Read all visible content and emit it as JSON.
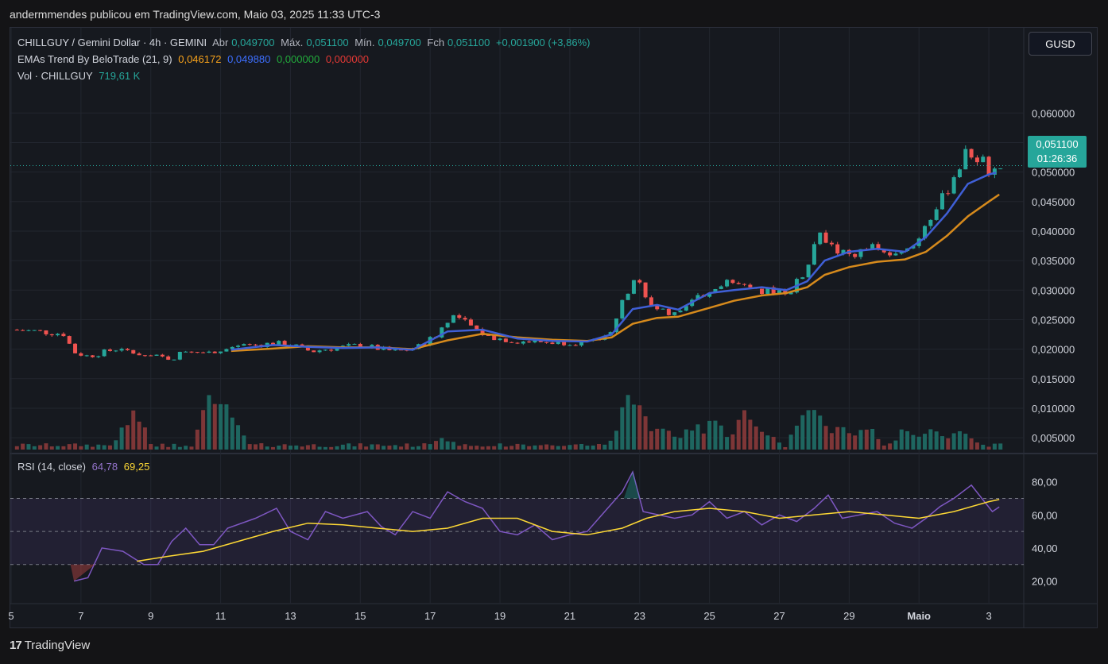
{
  "header": {
    "publisher_line": "andermmendes publicou em TradingView.com, Maio 03, 2025 11:33 UTC-3"
  },
  "symbol_legend": {
    "name": "CHILLGUY / Gemini Dollar · 4h · GEMINI",
    "open_label": "Abr",
    "open": "0,049700",
    "high_label": "Máx.",
    "high": "0,051100",
    "low_label": "Mín.",
    "low": "0,049700",
    "close_label": "Fch",
    "close": "0,051100",
    "change": "+0,001900 (+3,86%)"
  },
  "ema_legend": {
    "name": "EMAs Trend By BeloTrade (21, 9)",
    "v1": "0,046172",
    "v2": "0,049880",
    "v3": "0,000000",
    "v4": "0,000000"
  },
  "vol_legend": {
    "name": "Vol · CHILLGUY",
    "value": "719,61 K"
  },
  "rsi_legend": {
    "name": "RSI (14, close)",
    "rsi": "64,78",
    "ma": "69,25"
  },
  "currency_button": "GUSD",
  "price_tag": {
    "price": "0,051100",
    "countdown": "01:26:36"
  },
  "footer": {
    "brand": "TradingView",
    "logo_text": "17"
  },
  "colors": {
    "up": "#26a69a",
    "down": "#ef5350",
    "ema_fast": "#2962ff",
    "ema_slow": "#d68a1c",
    "rsi": "#7e57c2",
    "rsi_ma": "#fdd835"
  },
  "chart_data": {
    "type": "candlestick",
    "price_axis": {
      "range": [
        0.003,
        0.063
      ],
      "ticks": [
        "0,005000",
        "0,010000",
        "0,015000",
        "0,020000",
        "0,025000",
        "0,030000",
        "0,035000",
        "0,040000",
        "0,045000",
        "0,050000",
        "0,055000",
        "0,060000"
      ],
      "tick_values": [
        0.005,
        0.01,
        0.015,
        0.02,
        0.025,
        0.03,
        0.035,
        0.04,
        0.045,
        0.05,
        0.055,
        0.06
      ]
    },
    "rsi_axis": {
      "range": [
        15,
        88
      ],
      "ticks": [
        "20,00",
        "40,00",
        "60,00",
        "80,00"
      ],
      "tick_values": [
        20,
        40,
        60,
        80
      ],
      "bands": [
        30,
        50,
        70
      ]
    },
    "x_ticks": [
      {
        "label": "5",
        "day": 5
      },
      {
        "label": "7",
        "day": 7
      },
      {
        "label": "9",
        "day": 9
      },
      {
        "label": "11",
        "day": 11
      },
      {
        "label": "13",
        "day": 13
      },
      {
        "label": "15",
        "day": 15
      },
      {
        "label": "17",
        "day": 17
      },
      {
        "label": "19",
        "day": 19
      },
      {
        "label": "21",
        "day": 21
      },
      {
        "label": "23",
        "day": 23
      },
      {
        "label": "25",
        "day": 25
      },
      {
        "label": "27",
        "day": 27
      },
      {
        "label": "29",
        "day": 29
      },
      {
        "label": "Maio",
        "day": 31
      },
      {
        "label": "3",
        "day": 33
      }
    ],
    "close_series": {
      "description_days": [
        5,
        33.4
      ],
      "knots": [
        [
          5,
          0.0233
        ],
        [
          5.8,
          0.023
        ],
        [
          6.5,
          0.0226
        ],
        [
          6.8,
          0.0195
        ],
        [
          7.2,
          0.0188
        ],
        [
          8,
          0.02
        ],
        [
          9,
          0.0188
        ],
        [
          9.6,
          0.0184
        ],
        [
          10,
          0.0198
        ],
        [
          10.5,
          0.0198
        ],
        [
          10.8,
          0.0195
        ],
        [
          11,
          0.0198
        ],
        [
          11.6,
          0.0205
        ],
        [
          12.5,
          0.021
        ],
        [
          13,
          0.0208
        ],
        [
          13.6,
          0.0196
        ],
        [
          14,
          0.02
        ],
        [
          15,
          0.0207
        ],
        [
          15.6,
          0.02
        ],
        [
          16,
          0.0196
        ],
        [
          16.6,
          0.0202
        ],
        [
          17.2,
          0.0225
        ],
        [
          17.6,
          0.0258
        ],
        [
          18,
          0.0246
        ],
        [
          18.6,
          0.0222
        ],
        [
          19.4,
          0.0214
        ],
        [
          20.3,
          0.0212
        ],
        [
          21,
          0.0212
        ],
        [
          21.6,
          0.021
        ],
        [
          22.1,
          0.0225
        ],
        [
          22.6,
          0.029
        ],
        [
          22.9,
          0.0335
        ],
        [
          23.2,
          0.0282
        ],
        [
          23.7,
          0.0262
        ],
        [
          24.1,
          0.0255
        ],
        [
          24.6,
          0.0285
        ],
        [
          25.2,
          0.0308
        ],
        [
          25.7,
          0.0312
        ],
        [
          26.3,
          0.0295
        ],
        [
          26.8,
          0.03
        ],
        [
          27.3,
          0.0298
        ],
        [
          27.8,
          0.0335
        ],
        [
          28.1,
          0.0395
        ],
        [
          28.5,
          0.0372
        ],
        [
          28.9,
          0.0358
        ],
        [
          29.3,
          0.0365
        ],
        [
          29.7,
          0.0375
        ],
        [
          30.3,
          0.0355
        ],
        [
          30.8,
          0.037
        ],
        [
          31.2,
          0.0415
        ],
        [
          31.6,
          0.0445
        ],
        [
          32,
          0.0495
        ],
        [
          32.4,
          0.0535
        ],
        [
          32.8,
          0.052
        ],
        [
          33.1,
          0.0497
        ],
        [
          33.4,
          0.0511
        ]
      ]
    },
    "ema_fast_series": [
      [
        11.3,
        0.0199
      ],
      [
        12.5,
        0.0207
      ],
      [
        13.5,
        0.0204
      ],
      [
        14.5,
        0.0202
      ],
      [
        15.5,
        0.0203
      ],
      [
        16.5,
        0.0199
      ],
      [
        17.5,
        0.023
      ],
      [
        18.5,
        0.0233
      ],
      [
        19.5,
        0.0218
      ],
      [
        20.5,
        0.0214
      ],
      [
        21.5,
        0.0213
      ],
      [
        22.2,
        0.0225
      ],
      [
        22.8,
        0.0268
      ],
      [
        23.5,
        0.0275
      ],
      [
        24.1,
        0.0267
      ],
      [
        25,
        0.0295
      ],
      [
        25.7,
        0.03
      ],
      [
        26.5,
        0.0305
      ],
      [
        27.2,
        0.03
      ],
      [
        27.8,
        0.0315
      ],
      [
        28.3,
        0.035
      ],
      [
        29,
        0.0365
      ],
      [
        29.8,
        0.037
      ],
      [
        30.6,
        0.0365
      ],
      [
        31.2,
        0.039
      ],
      [
        31.8,
        0.043
      ],
      [
        32.4,
        0.048
      ],
      [
        33,
        0.0496
      ],
      [
        33.2,
        0.0499
      ]
    ],
    "ema_slow_series": [
      [
        11.3,
        0.0197
      ],
      [
        12.5,
        0.0201
      ],
      [
        13.5,
        0.0205
      ],
      [
        14.5,
        0.0203
      ],
      [
        15.5,
        0.0203
      ],
      [
        16.5,
        0.02
      ],
      [
        17.5,
        0.0215
      ],
      [
        18.5,
        0.0226
      ],
      [
        19.5,
        0.022
      ],
      [
        20.5,
        0.0216
      ],
      [
        21.5,
        0.0214
      ],
      [
        22.2,
        0.022
      ],
      [
        22.8,
        0.0243
      ],
      [
        23.5,
        0.0253
      ],
      [
        24.1,
        0.0255
      ],
      [
        25,
        0.027
      ],
      [
        25.7,
        0.0282
      ],
      [
        26.5,
        0.0291
      ],
      [
        27.2,
        0.0295
      ],
      [
        27.8,
        0.0305
      ],
      [
        28.3,
        0.0326
      ],
      [
        29,
        0.0339
      ],
      [
        29.8,
        0.0348
      ],
      [
        30.6,
        0.0352
      ],
      [
        31.2,
        0.0365
      ],
      [
        31.8,
        0.0392
      ],
      [
        32.4,
        0.0425
      ],
      [
        33,
        0.045
      ],
      [
        33.3,
        0.0462
      ]
    ],
    "volume_spikes": [
      [
        8.5,
        0.55
      ],
      [
        10.8,
        0.95
      ],
      [
        11.0,
        0.7
      ],
      [
        11.2,
        0.62
      ],
      [
        17.4,
        0.2
      ],
      [
        22.6,
        0.35
      ],
      [
        22.8,
        0.98
      ],
      [
        23.3,
        0.4
      ],
      [
        23.7,
        0.3
      ],
      [
        24.6,
        0.45
      ],
      [
        25.1,
        0.48
      ],
      [
        26.0,
        0.55
      ],
      [
        26.6,
        0.3
      ],
      [
        27.8,
        0.7
      ],
      [
        28.1,
        0.55
      ],
      [
        28.8,
        0.4
      ],
      [
        29.5,
        0.35
      ],
      [
        30.6,
        0.3
      ],
      [
        31.3,
        0.4
      ],
      [
        32.2,
        0.3
      ]
    ],
    "rsi_knots": [
      [
        6.8,
        20
      ],
      [
        7.2,
        22
      ],
      [
        7.6,
        40
      ],
      [
        8.2,
        38
      ],
      [
        8.8,
        30
      ],
      [
        9.2,
        30
      ],
      [
        9.6,
        44
      ],
      [
        10,
        52
      ],
      [
        10.4,
        42
      ],
      [
        10.8,
        42
      ],
      [
        11.2,
        52
      ],
      [
        12,
        58
      ],
      [
        12.6,
        64
      ],
      [
        13,
        50
      ],
      [
        13.5,
        45
      ],
      [
        14,
        62
      ],
      [
        14.5,
        58
      ],
      [
        15.2,
        62
      ],
      [
        15.6,
        53
      ],
      [
        16,
        48
      ],
      [
        16.5,
        62
      ],
      [
        17,
        58
      ],
      [
        17.5,
        74
      ],
      [
        18,
        68
      ],
      [
        18.5,
        64
      ],
      [
        19,
        50
      ],
      [
        19.5,
        48
      ],
      [
        20,
        54
      ],
      [
        20.5,
        45
      ],
      [
        21,
        48
      ],
      [
        21.5,
        50
      ],
      [
        22,
        62
      ],
      [
        22.5,
        74
      ],
      [
        22.8,
        86
      ],
      [
        23.1,
        62
      ],
      [
        24,
        58
      ],
      [
        24.5,
        60
      ],
      [
        25,
        68
      ],
      [
        25.5,
        58
      ],
      [
        26,
        62
      ],
      [
        26.5,
        54
      ],
      [
        27,
        60
      ],
      [
        27.5,
        56
      ],
      [
        28,
        64
      ],
      [
        28.4,
        72
      ],
      [
        28.8,
        58
      ],
      [
        29.3,
        60
      ],
      [
        29.8,
        62
      ],
      [
        30.3,
        55
      ],
      [
        30.8,
        52
      ],
      [
        31.2,
        58
      ],
      [
        31.6,
        65
      ],
      [
        32,
        70
      ],
      [
        32.5,
        78
      ],
      [
        32.8,
        70
      ],
      [
        33.1,
        62
      ],
      [
        33.3,
        64.8
      ]
    ],
    "rsi_ma_knots": [
      [
        8.6,
        32
      ],
      [
        9.5,
        35
      ],
      [
        10.5,
        38
      ],
      [
        11.5,
        44
      ],
      [
        12.5,
        50
      ],
      [
        13.5,
        55
      ],
      [
        14.5,
        54
      ],
      [
        15.5,
        52
      ],
      [
        16.5,
        50
      ],
      [
        17.5,
        52
      ],
      [
        18.5,
        58
      ],
      [
        19.5,
        58
      ],
      [
        20.5,
        50
      ],
      [
        21.5,
        48
      ],
      [
        22.5,
        52
      ],
      [
        23.2,
        58
      ],
      [
        24,
        62
      ],
      [
        25,
        64
      ],
      [
        26,
        62
      ],
      [
        27,
        58
      ],
      [
        28,
        60
      ],
      [
        29,
        62
      ],
      [
        30,
        60
      ],
      [
        31,
        58
      ],
      [
        32,
        62
      ],
      [
        33,
        68
      ],
      [
        33.3,
        69.3
      ]
    ]
  }
}
